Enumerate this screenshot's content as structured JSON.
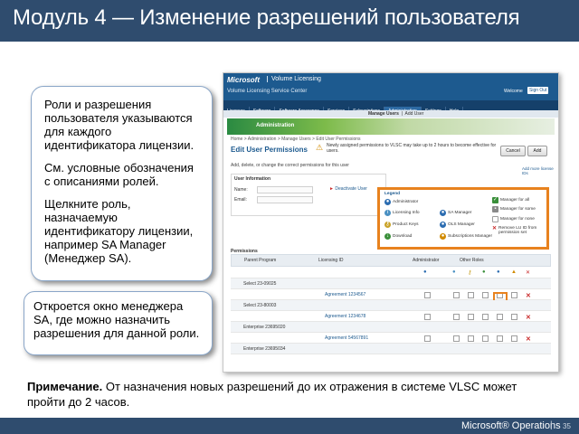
{
  "slide": {
    "title": "Модуль 4 — Изменение разрешений пользователя",
    "callout1": {
      "p1": "Роли и разрешения пользователя указываются для каждого идентификатора лицензии.",
      "p2": "См. условные обозначения с описаниями ролей.",
      "p3": "Щелкните роль, назначаемую идентификатору лицензии, например SA Manager (Менеджер SA)."
    },
    "callout2": "Откроется окно менеджера SA, где можно назначить разрешения для данной роли.",
    "note_label": "Примечание.",
    "note_text": " От назначения новых разрешений до их отражения в системе VLSC может пройти до 2 часов.",
    "footer_brand": "Microsoft® Operations",
    "footer_sep": "|",
    "page_number": "35"
  },
  "screenshot": {
    "header": {
      "brand": "Microsoft",
      "product": "Volume Licensing",
      "subtitle": "Volume Licensing Service Center",
      "welcome": "Welcome",
      "sign_out": "Sign Out"
    },
    "nav": [
      "Licenses",
      "Software",
      "Software Assurance",
      "Services",
      "Subscriptions",
      "Administration",
      "Settings",
      "Help"
    ],
    "subnav_manage": "Manage Users",
    "subnav_add": "Add User",
    "banner": "Administration",
    "breadcrumb": "Home > Administration > Manage Users > Edit User Permissions",
    "page_title": "Edit User Permissions",
    "warning": "Newly assigned permissions to VLSC may take up to 2 hours to become effective for users.",
    "cancel": "Cancel",
    "add": "Add",
    "hint": "Add, delete, or change the correct permissions for this user",
    "link_right": "Add more license IDs",
    "user_info": {
      "heading": "User Information",
      "name_label": "Name:",
      "email_label": "Email:",
      "deactivate": "Deactivate User"
    },
    "legend": {
      "title": "Legend",
      "items": [
        {
          "label": "Administrator",
          "icon": "person-icon",
          "color": "#2b6cb0"
        },
        {
          "label": "Licensing Info",
          "icon": "info-icon",
          "color": "#4a90c2"
        },
        {
          "label": "Product Keys",
          "icon": "key-icon",
          "color": "#c9a227"
        },
        {
          "label": "Download",
          "icon": "download-icon",
          "color": "#3a8f3a"
        },
        {
          "label": "SA Manager",
          "icon": "sa-manager-icon",
          "color": "#2b6cb0"
        },
        {
          "label": "OLS Manager",
          "icon": "ols-manager-icon",
          "color": "#2b6cb0"
        },
        {
          "label": "Subscriptions Manager",
          "icon": "subscriptions-icon",
          "color": "#d18a00"
        },
        {
          "label": "Manager for all",
          "icon": "manager-all-icon",
          "color": "#3a8f3a"
        },
        {
          "label": "Manager for some",
          "icon": "manager-some-icon",
          "color": "#8a8a8a"
        },
        {
          "label": "Manager for none",
          "icon": "manager-none-icon",
          "color": "#bdbdbd"
        },
        {
          "label": "Remove LU ID from permission set",
          "icon": "remove-icon",
          "color": "#c92a2a"
        }
      ]
    },
    "permissions_title": "Permissions",
    "table_headers": {
      "parent": "Parent Program",
      "licensing_id": "Licensing ID",
      "administrator": "Administrator",
      "other_roles": "Other Roles"
    },
    "rows": [
      {
        "type": "group",
        "program": "Select 23-09025",
        "lid": ""
      },
      {
        "type": "item",
        "program": "",
        "lid": "Agreement 1234567",
        "highlight": true
      },
      {
        "type": "group",
        "program": "Select 23-80003",
        "lid": ""
      },
      {
        "type": "item",
        "program": "",
        "lid": "Agreement 1234678"
      },
      {
        "type": "group",
        "program": "Enterprise 23695020",
        "lid": ""
      },
      {
        "type": "item",
        "program": "",
        "lid": "Agreement 54567891"
      },
      {
        "type": "group",
        "program": "Enterprise 23695034",
        "lid": ""
      }
    ]
  }
}
